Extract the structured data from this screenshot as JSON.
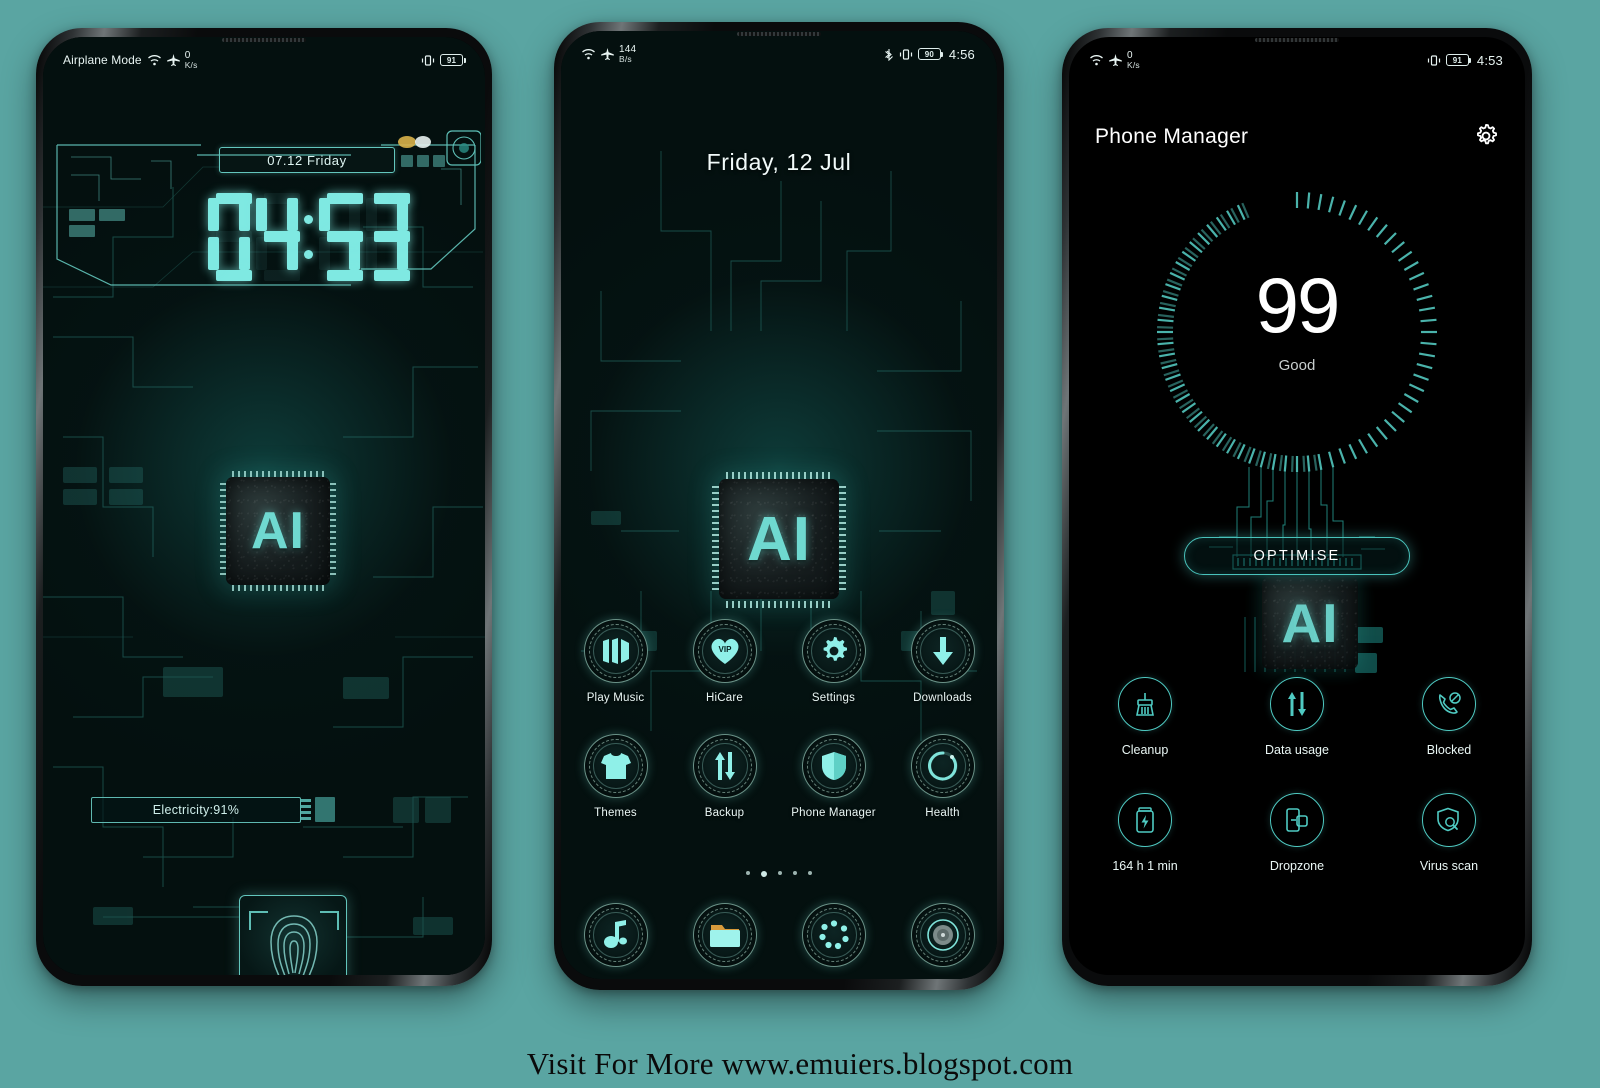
{
  "background_color": "#5aa5a2",
  "accent_color": "#6fd9d0",
  "footer": {
    "text": "Visit For More www.emuiers.blogspot.com"
  },
  "phone1": {
    "name": "lock-screen",
    "statusbar": {
      "airplane_label": "Airplane Mode",
      "wifi_icon": "wifi-icon",
      "airplane_icon": "airplane-icon",
      "net_rate_value": "0",
      "net_rate_unit": "K/s",
      "vibrate_icon": "vibrate-icon",
      "battery_text": "91"
    },
    "date_text": "07.12 Friday",
    "clock": {
      "hours": "04",
      "minutes": "53"
    },
    "electricity_text": "Electricity:91%",
    "chip_label": "AI",
    "fingerprint_icon": "fingerprint-icon"
  },
  "phone2": {
    "name": "home-screen",
    "statusbar": {
      "wifi_icon": "wifi-icon",
      "airplane_icon": "airplane-icon",
      "net_rate_value": "144",
      "net_rate_unit": "B/s",
      "bluetooth_icon": "bluetooth-icon",
      "vibrate_icon": "vibrate-icon",
      "battery_text": "90",
      "clock": "4:56"
    },
    "date_text": "Friday, 12 Jul",
    "chip_label": "AI",
    "apps": [
      {
        "label": "Play Music",
        "icon": "play-music-icon"
      },
      {
        "label": "HiCare",
        "icon": "heart-vip-icon",
        "badge": "VIP"
      },
      {
        "label": "Settings",
        "icon": "gear-icon"
      },
      {
        "label": "Downloads",
        "icon": "download-arrow-icon"
      },
      {
        "label": "Themes",
        "icon": "tshirt-icon"
      },
      {
        "label": "Backup",
        "icon": "updown-arrows-icon"
      },
      {
        "label": "Phone Manager",
        "icon": "shield-icon"
      },
      {
        "label": "Health",
        "icon": "progress-ring-icon"
      }
    ],
    "page_dots": {
      "count": 5,
      "active_index": 1
    },
    "dock": [
      {
        "label": "Music",
        "icon": "music-note-icon"
      },
      {
        "label": "Files",
        "icon": "folder-icon"
      },
      {
        "label": "Apps",
        "icon": "app-drawer-icon"
      },
      {
        "label": "Camera",
        "icon": "camera-icon"
      }
    ]
  },
  "phone3": {
    "name": "phone-manager-screen",
    "statusbar": {
      "wifi_icon": "wifi-icon",
      "airplane_icon": "airplane-icon",
      "net_rate_value": "0",
      "net_rate_unit": "K/s",
      "vibrate_icon": "vibrate-icon",
      "battery_text": "91",
      "clock": "4:53"
    },
    "title": "Phone Manager",
    "settings_icon": "gear-icon",
    "score": "99",
    "score_label": "Good",
    "optimise_label": "OPTIMISE",
    "chip_label": "AI",
    "features": [
      {
        "label": "Cleanup",
        "icon": "broom-icon"
      },
      {
        "label": "Data usage",
        "icon": "updown-arrows-icon"
      },
      {
        "label": "Blocked",
        "icon": "phone-blocked-icon"
      },
      {
        "label": "164 h 1 min",
        "icon": "battery-bolt-icon"
      },
      {
        "label": "Dropzone",
        "icon": "dropzone-icon"
      },
      {
        "label": "Virus scan",
        "icon": "shield-search-icon"
      }
    ]
  }
}
